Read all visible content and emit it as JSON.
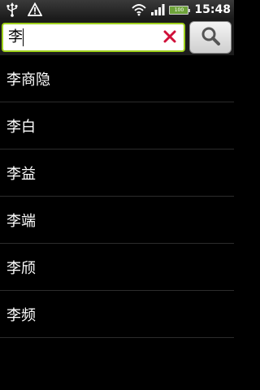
{
  "status_bar": {
    "time": "15:48",
    "battery_level": "100"
  },
  "search": {
    "query": "李"
  },
  "results": [
    {
      "label": "李商隐"
    },
    {
      "label": "李白"
    },
    {
      "label": "李益"
    },
    {
      "label": "李端"
    },
    {
      "label": "李颀"
    },
    {
      "label": "李频"
    }
  ],
  "colors": {
    "input_border": "#9fd11b",
    "clear_icon": "#d0103a",
    "battery_fill": "#6ea33a"
  }
}
